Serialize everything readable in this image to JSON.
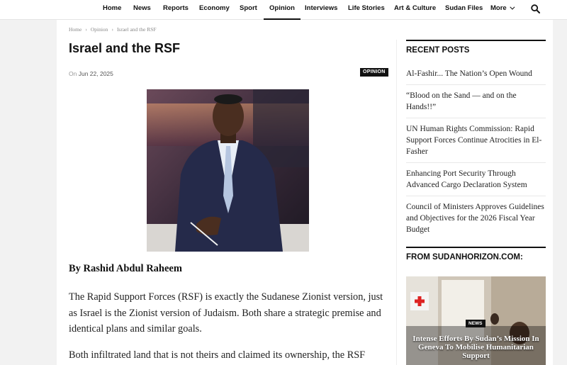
{
  "nav": {
    "items": [
      {
        "label": "Home"
      },
      {
        "label": "News"
      },
      {
        "label": "Reports"
      },
      {
        "label": "Economy"
      },
      {
        "label": "Sport"
      },
      {
        "label": "Opinion",
        "active": true
      },
      {
        "label": "Interviews"
      },
      {
        "label": "Life Stories"
      },
      {
        "label": "Art & Culture"
      },
      {
        "label": "Sudan Files"
      }
    ],
    "more_label": "More",
    "search_icon": "search-icon"
  },
  "breadcrumb": [
    "Home",
    "Opinion",
    "Israel and the RSF"
  ],
  "article": {
    "title": "Israel and the RSF",
    "meta_prefix": "On",
    "date": "Jun 22, 2025",
    "category_badge": "OPINION",
    "byline": "By Rashid Abdul Raheem",
    "paragraphs": [
      "The Rapid Support Forces (RSF) is exactly the Sudanese Zionist version, just as Israel is the Zionist version of Judaism. Both share a strategic premise and identical plans and similar goals.",
      "Both infiltrated land that is not theirs and claimed its ownership, the RSF"
    ]
  },
  "sidebar": {
    "recent_title": "RECENT POSTS",
    "recent_posts": [
      "Al-Fashir... The Nation’s Open Wound",
      "“Blood on the Sand — and on the Hands!!”",
      "UN Human Rights Commission: Rapid Support Forces Continue Atrocities in El-Fasher",
      "Enhancing Port Security Through Advanced Cargo Declaration System",
      "Council of Ministers Approves Guidelines and Objectives for the 2026 Fiscal Year Budget"
    ],
    "from_title": "FROM SUDANHORIZON.COM:",
    "promo": {
      "badge": "NEWS",
      "title": "Intense Efforts By Sudan’s Mission In Geneva To Mobilise Humanitarian Support"
    }
  },
  "colors": {
    "accent": "#111111",
    "page_bg": "#f2f2f2",
    "content_bg": "#ffffff"
  }
}
